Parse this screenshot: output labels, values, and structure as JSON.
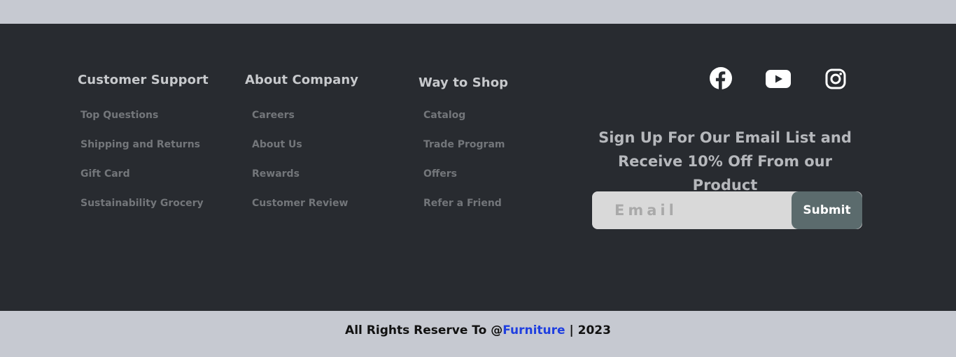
{
  "columns": [
    {
      "heading": "Customer Support",
      "links": [
        "Top Questions",
        "Shipping and Returns",
        "Gift Card",
        "Sustainability Grocery"
      ]
    },
    {
      "heading": "About Company",
      "links": [
        "Careers",
        "About Us",
        "Rewards",
        "Customer Review"
      ]
    },
    {
      "heading": "Way to Shop",
      "links": [
        "Catalog",
        "Trade Program",
        "Offers",
        "Refer a Friend"
      ]
    }
  ],
  "social": [
    "facebook-icon",
    "youtube-icon",
    "instagram-icon"
  ],
  "signup": {
    "line1": "Sign Up For Our Email List and",
    "line2": "Receive 10% Off From our Product",
    "placeholder": "Email",
    "submit_label": "Submit"
  },
  "footer": {
    "prefix": "All Rights Reserve To @",
    "brand": "Furniture",
    "suffix": " | 2023"
  },
  "colors": {
    "footer_bg": "#282b30",
    "page_bg": "#c6c9d1",
    "brand_link": "#1f3fe0",
    "submit_bg": "#5b6b6d"
  }
}
